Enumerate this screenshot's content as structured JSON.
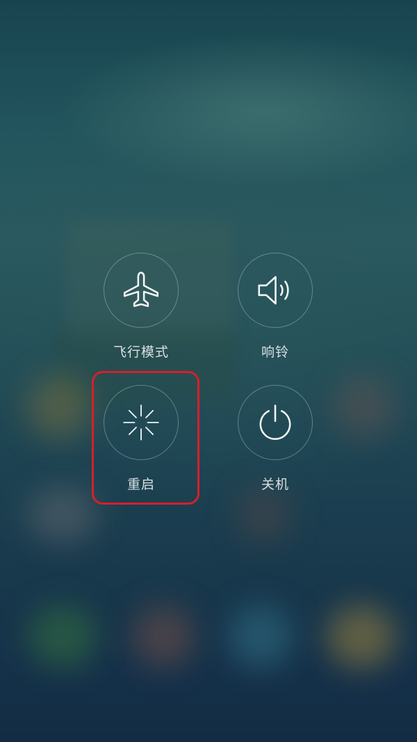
{
  "power_menu": {
    "airplane_mode": {
      "label": "飞行模式",
      "icon": "airplane-icon"
    },
    "ring": {
      "label": "响铃",
      "icon": "speaker-icon"
    },
    "reboot": {
      "label": "重启",
      "icon": "reboot-spinner-icon"
    },
    "power_off": {
      "label": "关机",
      "icon": "power-icon"
    }
  },
  "highlight": {
    "target": "reboot",
    "color": "#d81e2d"
  }
}
